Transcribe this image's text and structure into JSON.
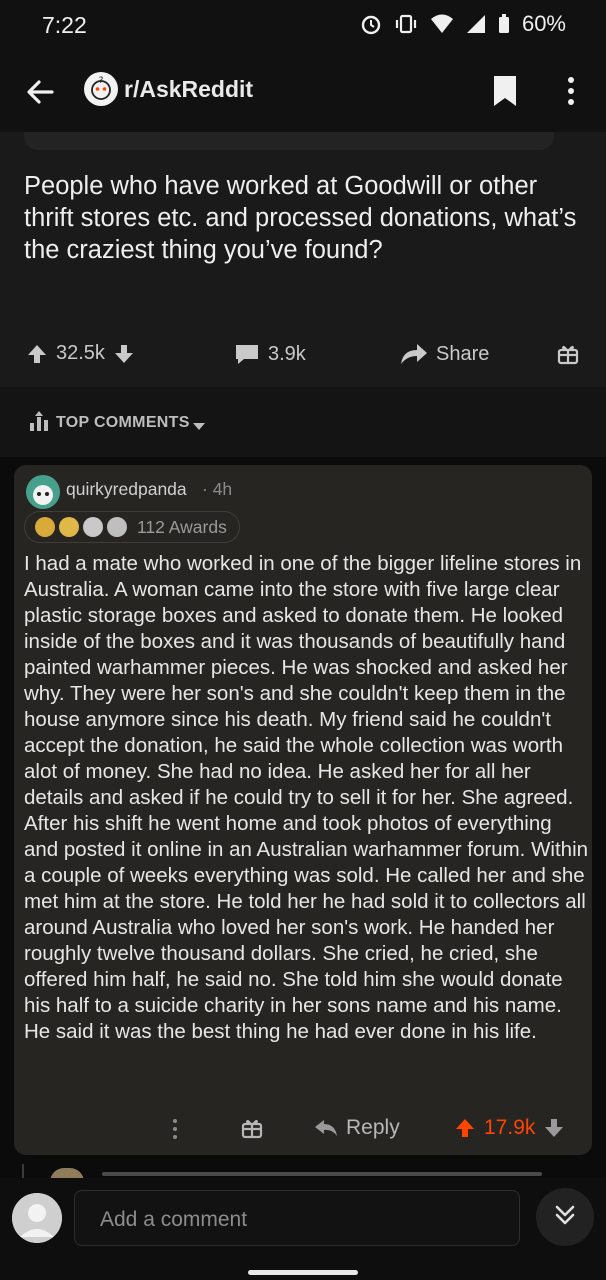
{
  "status_bar": {
    "time": "7:22",
    "battery": "60%"
  },
  "app_bar": {
    "subreddit": "r/AskReddit"
  },
  "post": {
    "title": "People who have worked at Goodwill or other thrift stores etc. and processed donations, what’s the craziest thing you’ve found?",
    "upvotes": "32.5k",
    "comments": "3.9k",
    "share_label": "Share"
  },
  "sort": {
    "label": "TOP COMMENTS"
  },
  "comment": {
    "author": "quirkyredpanda",
    "age": "4h",
    "awards_count": "112 Awards",
    "award_colors": [
      "#d9a93a",
      "#e0b84a",
      "#c9c9c9",
      "#bfbfbf"
    ],
    "body": "I had a mate who worked in one of the bigger lifeline stores in Australia. A woman came into the store with five large clear plastic storage boxes and asked to donate them. He looked inside of the boxes and it was thousands of beautifully hand painted warhammer pieces. He was shocked and asked her why. They were her son's and she couldn't keep them in the house anymore since his death. My friend said he couldn't accept the donation, he said the whole collection was worth alot of money. She had no idea. He asked her for all her details and asked if he could try to sell it for her. She agreed. After his shift he went home and took photos of everything and posted it online in an Australian warhammer forum. Within a couple of weeks everything was sold. He called her and she met him at the store. He told her he had sold it to collectors all around Australia who loved her son's work. He handed her roughly twelve thousand dollars. She cried, he cried, she offered him half,  he said no. She told him she would donate his half to a suicide charity in her sons name and his name. He said it was the best thing he had ever done in his life.",
    "reply_label": "Reply",
    "score": "17.9k"
  },
  "bottom_bar": {
    "placeholder": "Add a comment"
  },
  "colors": {
    "upvote_active": "#ff4500",
    "card_bg": "#262521",
    "page_bg": "#0b0b0b"
  }
}
